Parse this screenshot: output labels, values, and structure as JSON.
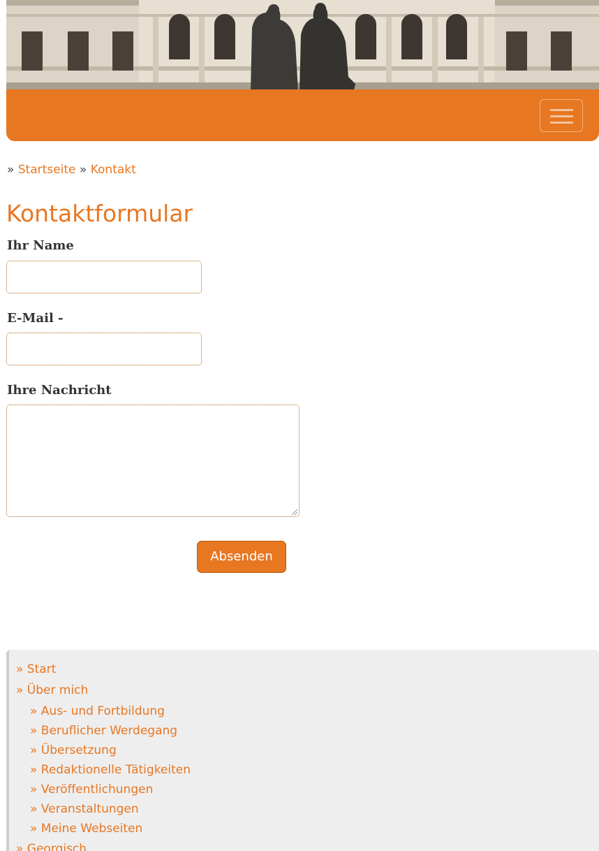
{
  "header": {
    "banner_alt": "Goethe-Schiller-Denkmal",
    "menu_button": "menu-toggle"
  },
  "breadcrumb": {
    "sep1": "»",
    "home": "Startseite",
    "sep2": "»",
    "current": "Kontakt"
  },
  "page": {
    "title": "Kontaktformular"
  },
  "form": {
    "name_label": "Ihr Name",
    "name_value": "",
    "email_label": "E-Mail -",
    "email_value": "",
    "message_label": "Ihre Nachricht",
    "message_value": "",
    "submit_label": "Absenden"
  },
  "sidenav": {
    "items": [
      {
        "label": "» Start"
      },
      {
        "label": "» Über mich"
      },
      {
        "label": "» Aus- und Fortbildung"
      },
      {
        "label": "» Beruflicher Werdegang"
      },
      {
        "label": "» Übersetzung"
      },
      {
        "label": "» Redaktionelle Tätigkeiten"
      },
      {
        "label": "» Veröffentlichungen"
      },
      {
        "label": "» Veranstaltungen"
      },
      {
        "label": "» Meine Webseiten"
      },
      {
        "label": "» Georgisch"
      }
    ]
  },
  "colors": {
    "accent": "#e87722",
    "sidebar_bg": "#eeeeee"
  }
}
